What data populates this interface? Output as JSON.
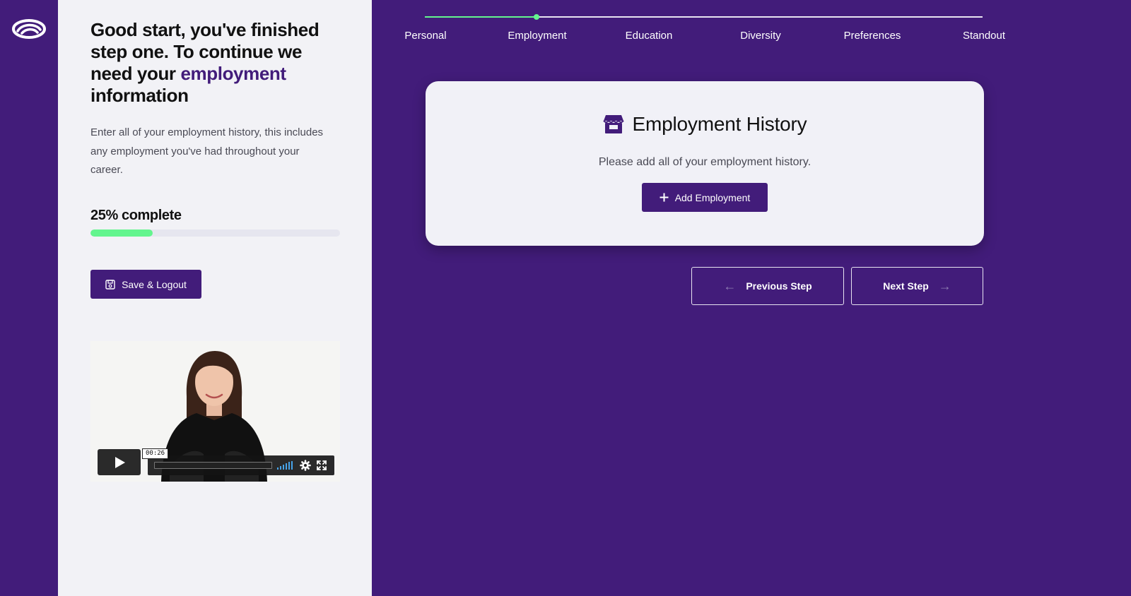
{
  "app": {
    "logo_icon": "eye-logo-icon"
  },
  "left_panel": {
    "headline_part1": "Good start, you've finished step one. To continue we need your ",
    "headline_accent": "employment",
    "headline_part2": " information",
    "intro": "Enter all of your employment history, this includes any employment you've had throughout your career.",
    "progress_label": "25% complete",
    "progress_value": 0.25,
    "save_button": {
      "label": "Save & Logout",
      "icon": "floppy-disk-icon"
    },
    "video": {
      "time": "00:26"
    }
  },
  "stepper": {
    "steps": [
      "Personal",
      "Employment",
      "Education",
      "Diversity",
      "Preferences",
      "Standout"
    ],
    "current_index": 1
  },
  "card": {
    "icon": "storefront-icon",
    "title": "Employment History",
    "subtitle": "Please add all of your employment history.",
    "add_button": {
      "label": "Add Employment",
      "icon": "plus-icon"
    }
  },
  "navigation": {
    "previous_label": "Previous Step",
    "next_label": "Next Step"
  },
  "colors": {
    "brand_purple": "#421c7a",
    "progress_green": "#63f58e",
    "panel_bg": "#f2f2f6"
  }
}
